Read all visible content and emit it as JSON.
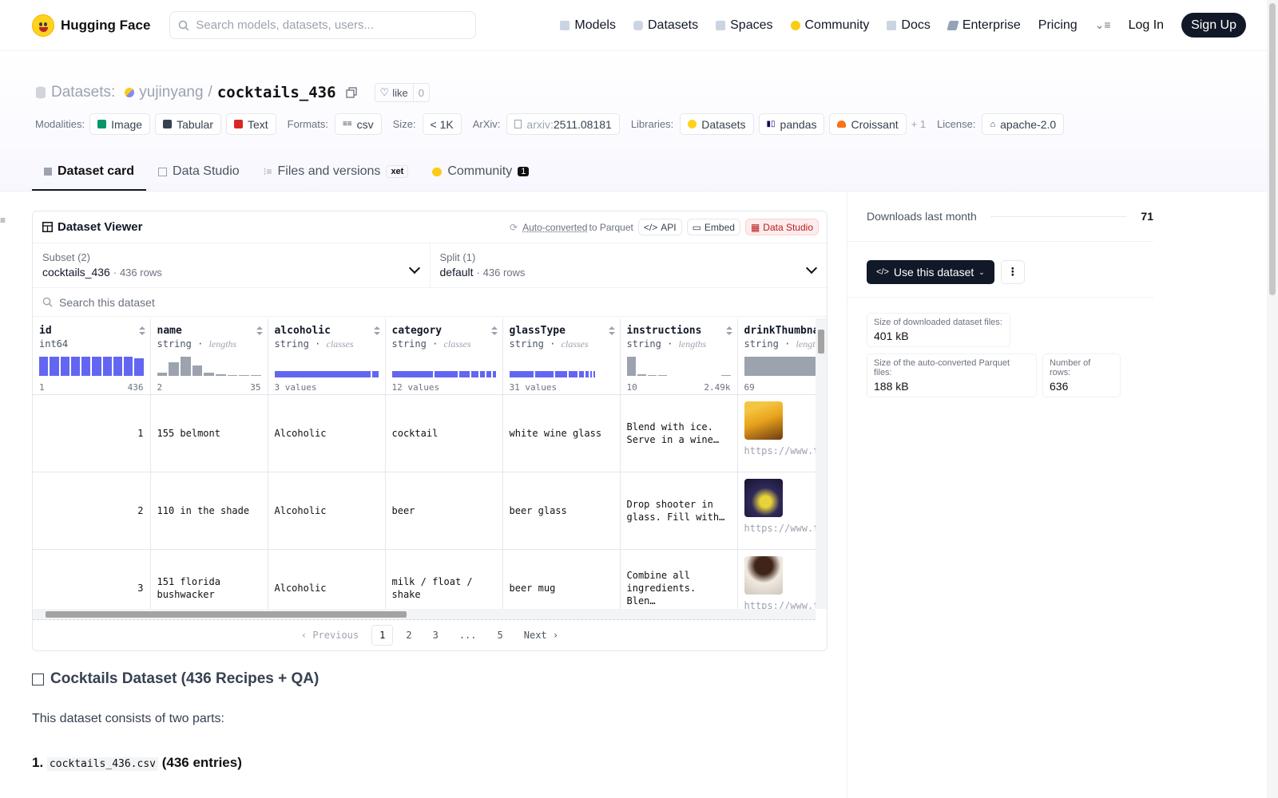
{
  "nav": {
    "brand": "Hugging Face",
    "search_placeholder": "Search models, datasets, users...",
    "links": [
      {
        "label": "Models",
        "icon": "models-icon",
        "color": "#9ca3af"
      },
      {
        "label": "Datasets",
        "icon": "datasets-icon",
        "color": "#9ca3af"
      },
      {
        "label": "Spaces",
        "icon": "spaces-icon",
        "color": "#9ca3af"
      },
      {
        "label": "Community",
        "icon": "community-icon",
        "color": "#facc15"
      },
      {
        "label": "Docs",
        "icon": "docs-icon",
        "color": "#9ca3af"
      },
      {
        "label": "Enterprise",
        "icon": "enterprise-icon",
        "color": "#9ca3af"
      },
      {
        "label": "Pricing",
        "icon": "",
        "color": ""
      }
    ],
    "login": "Log In",
    "signup": "Sign Up"
  },
  "header": {
    "section": "Datasets:",
    "owner": "yujinyang",
    "slash": "/",
    "name": "cocktails_436",
    "like_label": "like",
    "like_count": "0",
    "modalities_label": "Modalities:",
    "modalities": [
      "Image",
      "Tabular",
      "Text"
    ],
    "formats_label": "Formats:",
    "format": "csv",
    "size_label": "Size:",
    "size": "< 1K",
    "arxiv_label": "ArXiv:",
    "arxiv_prefix": "arxiv:",
    "arxiv_id": "2511.08181",
    "libraries_label": "Libraries:",
    "libraries": [
      "Datasets",
      "pandas",
      "Croissant"
    ],
    "libraries_more": "+ 1",
    "license_label": "License:",
    "license": "apache-2.0"
  },
  "tabs": [
    {
      "label": "Dataset card",
      "active": true
    },
    {
      "label": "Data Studio",
      "active": false
    },
    {
      "label": "Files and versions",
      "active": false,
      "extra": "xet"
    },
    {
      "label": "Community",
      "active": false,
      "badge": "1"
    }
  ],
  "viewer": {
    "title": "Dataset Viewer",
    "auto_converted": "Auto-converted",
    "to_parquet": "to Parquet",
    "api": "API",
    "embed": "Embed",
    "data_studio": "Data Studio",
    "subset_label": "Subset (2)",
    "subset_value": "cocktails_436",
    "subset_rows": "436 rows",
    "split_label": "Split (1)",
    "split_value": "default",
    "split_rows": "436 rows",
    "dot": "·",
    "search_placeholder": "Search this dataset",
    "columns": [
      {
        "name": "id",
        "type": "int64",
        "kind": "",
        "foot_left": "1",
        "foot_right": "436"
      },
      {
        "name": "name",
        "type": "string",
        "kind": "lengths",
        "foot_left": "2",
        "foot_right": "35"
      },
      {
        "name": "alcoholic",
        "type": "string",
        "kind": "classes",
        "foot_left": "3 values",
        "foot_right": ""
      },
      {
        "name": "category",
        "type": "string",
        "kind": "classes",
        "foot_left": "12 values",
        "foot_right": ""
      },
      {
        "name": "glassType",
        "type": "string",
        "kind": "classes",
        "foot_left": "31 values",
        "foot_right": ""
      },
      {
        "name": "instructions",
        "type": "string",
        "kind": "lengths",
        "foot_left": "10",
        "foot_right": "2.49k"
      },
      {
        "name": "drinkThumbnail",
        "type": "string",
        "kind": "lengths",
        "foot_left": "69",
        "foot_right": ""
      }
    ],
    "rows": [
      {
        "id": "1",
        "name": "155 belmont",
        "alcoholic": "Alcoholic",
        "category": "cocktail",
        "glassType": "white wine glass",
        "instructions": "Blend with ice. Serve in a wine…",
        "url": "https://www.thecocktaildb.com/images/media/drink/yqvvqs1475667388.jpg",
        "thumb_colors": [
          "#e8a21b",
          "#6b3a14"
        ]
      },
      {
        "id": "2",
        "name": "110 in the shade",
        "alcoholic": "Alcoholic",
        "category": "beer",
        "glassType": "beer glass",
        "instructions": "Drop shooter in glass. Fill with…",
        "url": "https://www.thecocktaildb.com/images/media/drink/xxyywq1454511117.jpg",
        "thumb_colors": [
          "#d7c23a",
          "#2f2a5a"
        ]
      },
      {
        "id": "3",
        "name": "151 florida bushwacker",
        "alcoholic": "Alcoholic",
        "category": "milk / float / shake",
        "glassType": "beer mug",
        "instructions": "Combine all ingredients. Blen…",
        "url": "https://www.thecocktaildb.com/images/media/drink/rvwrvv1468877323.jpg",
        "thumb_colors": [
          "#f1e9e0",
          "#3f2417"
        ]
      }
    ],
    "pager": {
      "prev": "Previous",
      "pages": [
        "1",
        "2",
        "3",
        "...",
        "5"
      ],
      "current": "1",
      "next": "Next"
    }
  },
  "card": {
    "title": "Cocktails Dataset (436 Recipes + QA)",
    "intro": "This dataset consists of two parts:",
    "item_number": "1.",
    "item_file": "cocktails_436.csv",
    "item_note": "(436 entries)"
  },
  "sidebar": {
    "downloads_label": "Downloads last month",
    "downloads_value": "71",
    "use_button": "Use this dataset",
    "more_menu": "⋮",
    "stats": [
      {
        "label": "Size of downloaded dataset files:",
        "value": "401 kB"
      },
      {
        "label": "Size of the auto-converted Parquet files:",
        "value": "188 kB"
      },
      {
        "label": "Number of rows:",
        "value": "636"
      }
    ]
  },
  "colors": {
    "accent": "#6366f1",
    "brand": "#ffd21e",
    "dark": "#111827"
  }
}
